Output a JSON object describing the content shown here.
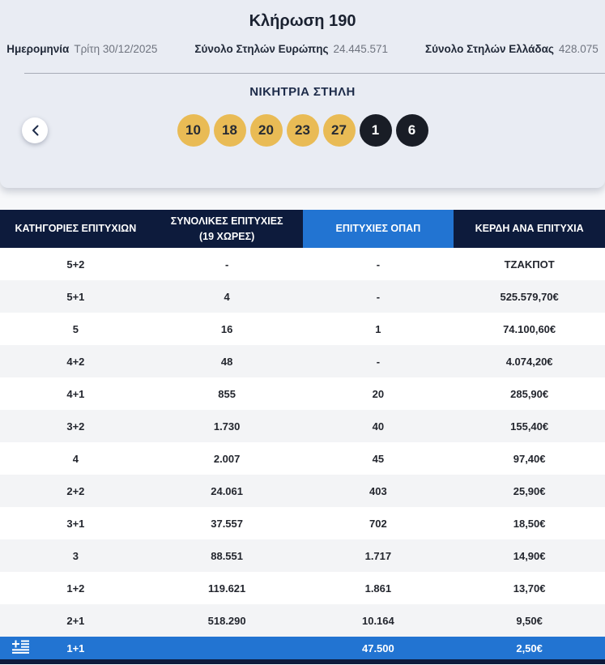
{
  "header": {
    "title": "Κλήρωση 190",
    "meta": [
      {
        "label": "Ημερομηνία",
        "value": "Τρίτη 30/12/2025"
      },
      {
        "label": "Σύνολο Στηλών Ευρώπης",
        "value": "24.445.571"
      },
      {
        "label": "Σύνολο Στηλών Ελλάδας",
        "value": "428.075"
      }
    ]
  },
  "winning_section": {
    "title": "ΝΙΚΗΤΡΙΑ ΣΤΗΛΗ",
    "prev_button_icon": "chevron-left-icon",
    "numbers": [
      {
        "value": "10",
        "type": "main"
      },
      {
        "value": "18",
        "type": "main"
      },
      {
        "value": "20",
        "type": "main"
      },
      {
        "value": "23",
        "type": "main"
      },
      {
        "value": "27",
        "type": "main"
      },
      {
        "value": "1",
        "type": "bonus"
      },
      {
        "value": "6",
        "type": "bonus"
      }
    ]
  },
  "table": {
    "columns": [
      {
        "label": "ΚΑΤΗΓΟΡΙΕΣ ΕΠΙΤΥΧΙΩΝ",
        "sublabel": "",
        "highlighted": false
      },
      {
        "label": "ΣΥΝΟΛΙΚΕΣ ΕΠΙΤΥΧΙΕΣ",
        "sublabel": "(19 ΧΩΡΕΣ)",
        "highlighted": false
      },
      {
        "label": "ΕΠΙΤΥΧΙΕΣ ΟΠΑΠ",
        "sublabel": "",
        "highlighted": true
      },
      {
        "label": "ΚΕΡΔΗ ΑΝΑ ΕΠΙΤΥΧΙΑ",
        "sublabel": "",
        "highlighted": false
      }
    ],
    "rows": [
      {
        "category": "5+2",
        "total_wins": "-",
        "opap_wins": "-",
        "prize": "ΤΖΑΚΠΟΤ",
        "highlight": false
      },
      {
        "category": "5+1",
        "total_wins": "4",
        "opap_wins": "-",
        "prize": "525.579,70€",
        "highlight": false
      },
      {
        "category": "5",
        "total_wins": "16",
        "opap_wins": "1",
        "prize": "74.100,60€",
        "highlight": false
      },
      {
        "category": "4+2",
        "total_wins": "48",
        "opap_wins": "-",
        "prize": "4.074,20€",
        "highlight": false
      },
      {
        "category": "4+1",
        "total_wins": "855",
        "opap_wins": "20",
        "prize": "285,90€",
        "highlight": false
      },
      {
        "category": "3+2",
        "total_wins": "1.730",
        "opap_wins": "40",
        "prize": "155,40€",
        "highlight": false
      },
      {
        "category": "4",
        "total_wins": "2.007",
        "opap_wins": "45",
        "prize": "97,40€",
        "highlight": false
      },
      {
        "category": "2+2",
        "total_wins": "24.061",
        "opap_wins": "403",
        "prize": "25,90€",
        "highlight": false
      },
      {
        "category": "3+1",
        "total_wins": "37.557",
        "opap_wins": "702",
        "prize": "18,50€",
        "highlight": false
      },
      {
        "category": "3",
        "total_wins": "88.551",
        "opap_wins": "1.717",
        "prize": "14,90€",
        "highlight": false
      },
      {
        "category": "1+2",
        "total_wins": "119.621",
        "opap_wins": "1.861",
        "prize": "13,70€",
        "highlight": false
      },
      {
        "category": "2+1",
        "total_wins": "518.290",
        "opap_wins": "10.164",
        "prize": "9,50€",
        "highlight": false
      },
      {
        "category": "1+1",
        "total_wins": "",
        "opap_wins": "47.500",
        "prize": "2,50€",
        "highlight": true,
        "flag_icon": "greek-flag-icon"
      }
    ]
  },
  "colors": {
    "main_ball": "#e9bb55",
    "bonus_ball": "#191d26",
    "header_navy": "#0d1b3c",
    "accent_blue": "#2274d2",
    "card_bg": "#e9ecf3",
    "alt_row_bg": "#f3f4f6"
  }
}
